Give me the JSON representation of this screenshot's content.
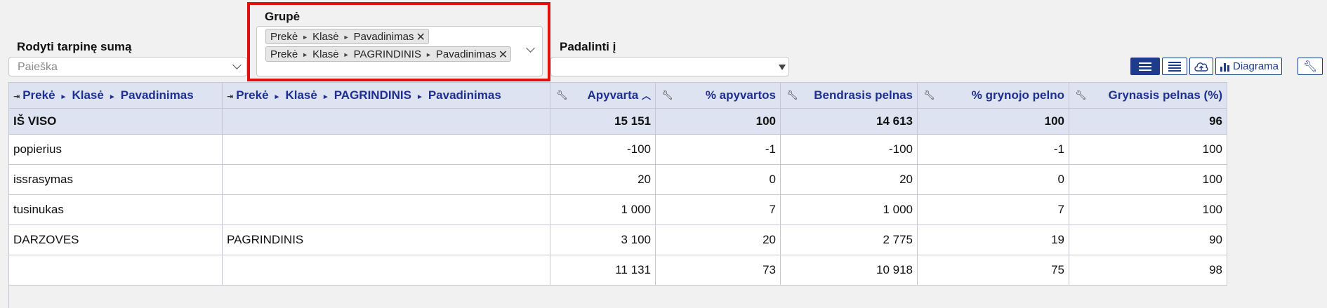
{
  "filters": {
    "subtotal_label": "Rodyti tarpinę sumą",
    "subtotal_placeholder": "Paieška",
    "group_label": "Grupė",
    "group_tags": [
      {
        "parts": [
          "Prekė",
          "Klasė",
          "Pavadinimas"
        ]
      },
      {
        "parts": [
          "Prekė",
          "Klasė",
          "PAGRINDINIS",
          "Pavadinimas"
        ]
      }
    ],
    "split_label": "Padalinti į",
    "split_value": ""
  },
  "toolbar": {
    "diagram_label": "Diagrama",
    "icons": [
      "list-view-icon",
      "compact-list-icon",
      "cloud-upload-icon",
      "bar-chart-icon",
      "wrench-icon"
    ]
  },
  "table": {
    "columns": [
      {
        "parts": [
          "Prekė",
          "Klasė",
          "Pavadinimas"
        ]
      },
      {
        "parts": [
          "Prekė",
          "Klasė",
          "PAGRINDINIS",
          "Pavadinimas"
        ]
      },
      {
        "label": "Apyvarta",
        "sort": "asc"
      },
      {
        "label": "% apyvartos"
      },
      {
        "label": "Bendrasis pelnas"
      },
      {
        "label": "% grynojo pelno"
      },
      {
        "label": "Grynasis pelnas (%)"
      }
    ],
    "total_row": [
      "IŠ VISO",
      "",
      "15 151",
      "100",
      "14 613",
      "100",
      "96"
    ],
    "rows": [
      [
        "popierius",
        "",
        "-100",
        "-1",
        "-100",
        "-1",
        "100"
      ],
      [
        "issrasymas",
        "",
        "20",
        "0",
        "20",
        "0",
        "100"
      ],
      [
        "tusinukas",
        "",
        "1 000",
        "7",
        "1 000",
        "7",
        "100"
      ],
      [
        "DARZOVES",
        "PAGRINDINIS",
        "3 100",
        "20",
        "2 775",
        "19",
        "90"
      ],
      [
        "",
        "",
        "11 131",
        "73",
        "10 918",
        "75",
        "98"
      ]
    ]
  }
}
